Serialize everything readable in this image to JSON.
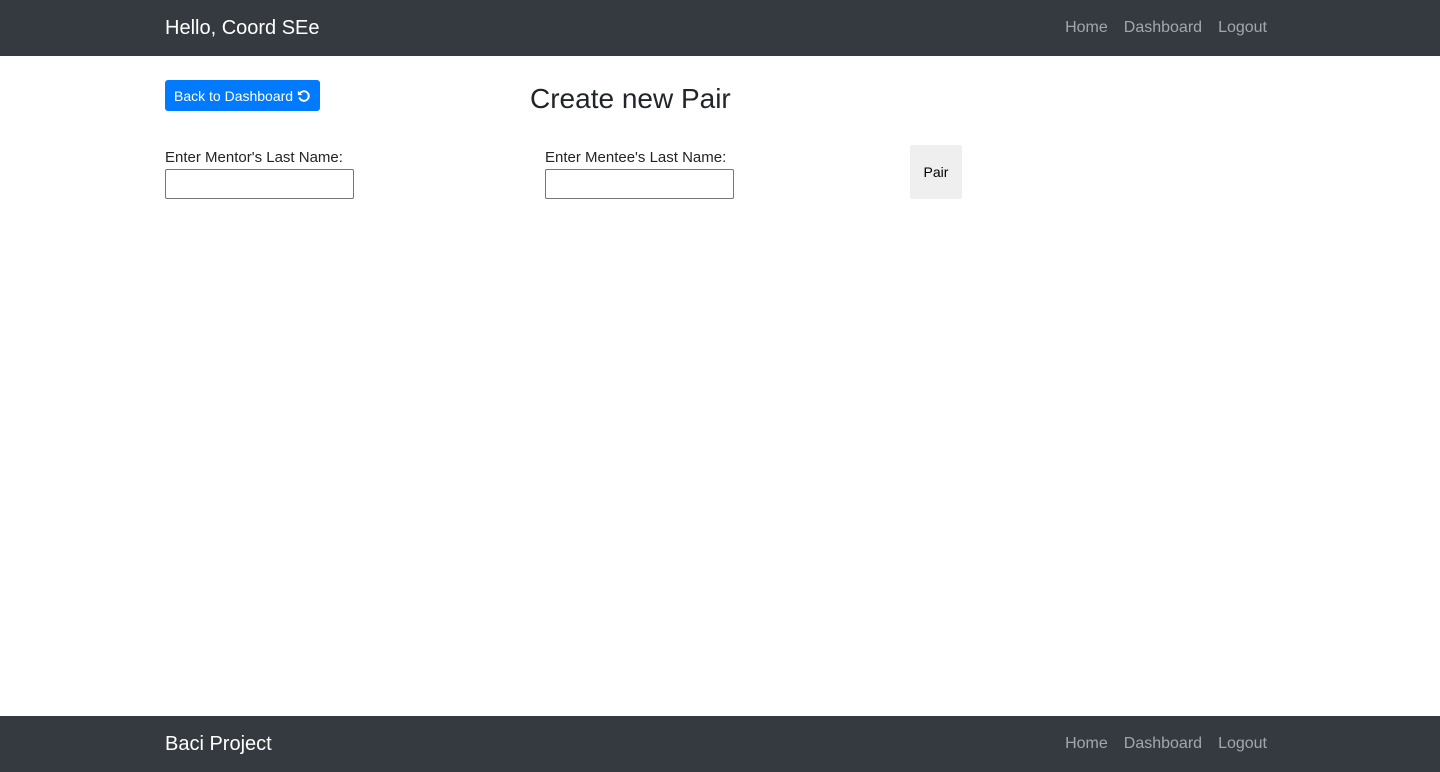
{
  "header": {
    "brand": "Hello, Coord SEe",
    "nav": [
      {
        "label": "Home"
      },
      {
        "label": "Dashboard"
      },
      {
        "label": "Logout"
      }
    ]
  },
  "main": {
    "back_button": {
      "label": "Back to Dashboard",
      "icon": "undo-icon"
    },
    "title": "Create new Pair",
    "mentor": {
      "label": "Enter Mentor's Last Name:",
      "value": "",
      "placeholder": ""
    },
    "mentee": {
      "label": "Enter Mentee's Last Name:",
      "value": "",
      "placeholder": ""
    },
    "pair_button": {
      "label": "Pair"
    }
  },
  "footer": {
    "brand": "Baci Project",
    "nav": [
      {
        "label": "Home"
      },
      {
        "label": "Dashboard"
      },
      {
        "label": "Logout"
      }
    ]
  },
  "colors": {
    "navbar_bg": "#343a40",
    "primary": "#007bff",
    "nav_link": "rgba(255,255,255,0.55)",
    "button_gray": "#efefef"
  }
}
